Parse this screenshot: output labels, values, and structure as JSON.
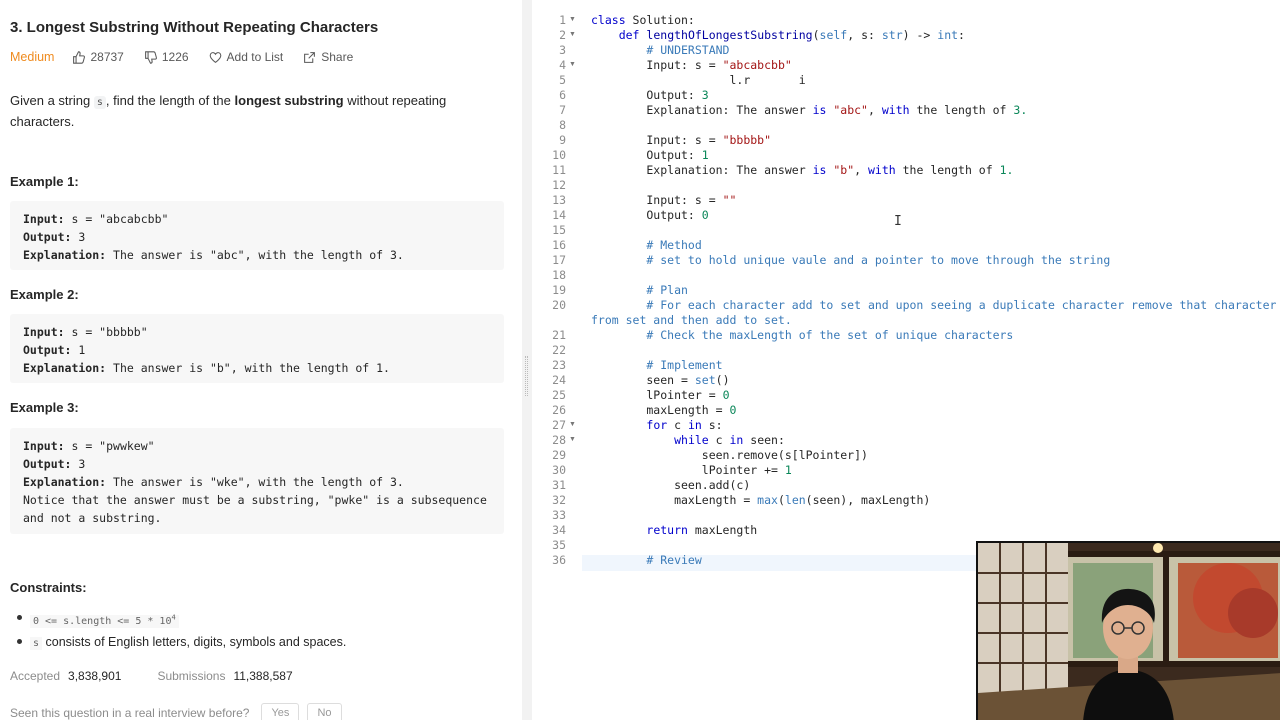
{
  "problem": {
    "title": "3. Longest Substring Without Repeating Characters",
    "difficulty": "Medium",
    "likes": "28737",
    "dislikes": "1226",
    "add_to_list": "Add to List",
    "share": "Share",
    "description_pre": "Given a string ",
    "description_var": "s",
    "description_mid": ", find the length of the ",
    "description_bold": "longest substring",
    "description_post": " without repeating characters."
  },
  "examples": [
    {
      "title": "Example 1:",
      "input_label": "Input:",
      "input": "s = \"abcabcbb\"",
      "output_label": "Output:",
      "output": "3",
      "explanation_label": "Explanation:",
      "explanation": "The answer is \"abc\", with the length of 3.",
      "note": ""
    },
    {
      "title": "Example 2:",
      "input_label": "Input:",
      "input": "s = \"bbbbb\"",
      "output_label": "Output:",
      "output": "1",
      "explanation_label": "Explanation:",
      "explanation": "The answer is \"b\", with the length of 1.",
      "note": ""
    },
    {
      "title": "Example 3:",
      "input_label": "Input:",
      "input": "s = \"pwwkew\"",
      "output_label": "Output:",
      "output": "3",
      "explanation_label": "Explanation:",
      "explanation": "The answer is \"wke\", with the length of 3.",
      "note": "Notice that the answer must be a substring, \"pwke\" is a subsequence and not a substring."
    }
  ],
  "constraints": {
    "title": "Constraints:",
    "c1_code": "0 <= s.length <= 5 * 10",
    "c1_sup": "4",
    "c2_code": "s",
    "c2_text": " consists of English letters, digits, symbols and spaces."
  },
  "stats": {
    "accepted_label": "Accepted",
    "accepted": "3,838,901",
    "submissions_label": "Submissions",
    "submissions": "11,388,587"
  },
  "interview": {
    "question": "Seen this question in a real interview before?",
    "yes": "Yes",
    "no": "No"
  },
  "editor": {
    "line_numbers": [
      "1",
      "2",
      "3",
      "4",
      "5",
      "6",
      "7",
      "8",
      "9",
      "10",
      "11",
      "12",
      "13",
      "14",
      "15",
      "16",
      "17",
      "18",
      "19",
      "20",
      "21",
      "22",
      "23",
      "24",
      "25",
      "26",
      "27",
      "28",
      "29",
      "30",
      "31",
      "32",
      "33",
      "34",
      "35",
      "36"
    ],
    "fold_lines": [
      "1",
      "2",
      "4",
      "27",
      "28"
    ]
  },
  "webcam": {
    "description_icon": "presenter-video-icon"
  }
}
